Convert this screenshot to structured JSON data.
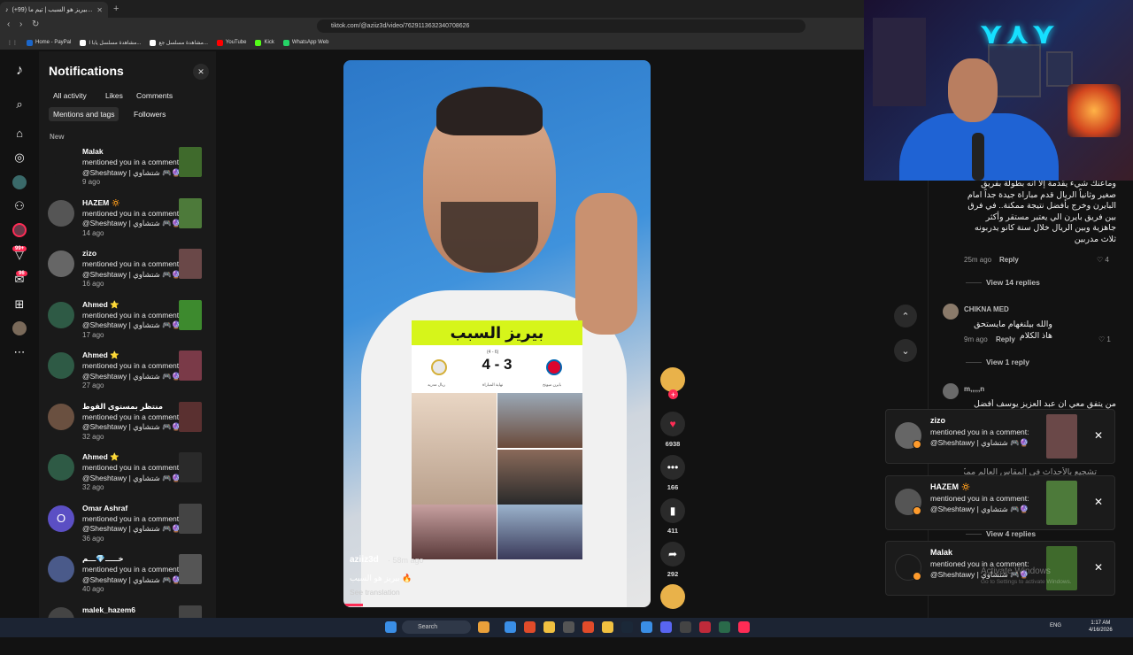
{
  "browser": {
    "tab_title": "(+99) بيريز هو السبب | تيم ما...",
    "url": "tiktok.com/@aziiz3d/video/7629113632340708626",
    "bookmarks": [
      {
        "label": "Home - PayPal",
        "color": "#1b66c9"
      },
      {
        "label": "مشاهدة مسلسل يابا ا...",
        "color": "#ffffff"
      },
      {
        "label": "مشاهدة مسلسل جع...",
        "color": "#ffffff"
      },
      {
        "label": "YouTube",
        "color": "#ff0000"
      },
      {
        "label": "Kick",
        "color": "#53fc18"
      },
      {
        "label": "WhatsApp Web",
        "color": "#25d366"
      }
    ]
  },
  "rail": {
    "icons": [
      "tiktok-logo-icon",
      "search-icon",
      "home-icon",
      "explore-icon",
      "following-icon",
      "friends-icon",
      "live-icon",
      "activity-icon",
      "messages-icon",
      "upload-icon",
      "profile-icon",
      "more-icon"
    ],
    "activity_badge": "99+",
    "messages_badge": "96"
  },
  "notifications": {
    "title": "Notifications",
    "filters": [
      "All activity",
      "Likes",
      "Comments"
    ],
    "filters2": [
      "Mentions and tags",
      "Followers"
    ],
    "section": "New",
    "items": [
      {
        "user": "Malak",
        "text": "mentioned you in a comment: @Sheshtawy | شتشاوي 🎮🔮",
        "time": "9 ago",
        "avatar": "#1a1a1a",
        "thumb": "#3f6a2c"
      },
      {
        "user": "HAZEM 🔅",
        "text": "mentioned you in a comment: @Sheshtawy | شتشاوي 🎮🔮",
        "time": "14 ago",
        "avatar": "#555",
        "thumb": "#4d7a3a"
      },
      {
        "user": "zizo",
        "text": "mentioned you in a comment: @Sheshtawy | شتشاوي 🎮🔮",
        "time": "16 ago",
        "avatar": "#666",
        "thumb": "#6a4848"
      },
      {
        "user": "Ahmed ⭐",
        "text": "mentioned you in a comment: @Sheshtawy | شتشاوي 🎮🔮",
        "time": "17 ago",
        "avatar": "#2e5a45",
        "thumb": "#3d8a2e"
      },
      {
        "user": "Ahmed ⭐",
        "text": "mentioned you in a comment: @Sheshtawy | شتشاوي 🎮🔮",
        "time": "27 ago",
        "avatar": "#2e5a45",
        "thumb": "#7a3a48"
      },
      {
        "user": "منتظر بمستوى القوط",
        "text": "mentioned you in a comment: @Sheshtawy | شتشاوي 🎮🔮",
        "time": "32 ago",
        "avatar": "#6a5040",
        "thumb": "#5a3030"
      },
      {
        "user": "Ahmed ⭐",
        "text": "mentioned you in a comment: @Sheshtawy | شتشاوي 🎮🔮",
        "time": "32 ago",
        "avatar": "#2e5a45",
        "thumb": "#2a2a2a"
      },
      {
        "user": "Omar Ashraf",
        "text": "mentioned you in a comment: @Sheshtawy | شتشاوي 🎮🔮",
        "time": "36 ago",
        "avatar": "#5b4fc4",
        "thumb": "#444",
        "initial": "O"
      },
      {
        "user": "خـــــ💎ـــم",
        "text": "mentioned you in a comment: @Sheshtawy | شتشاوي 🎮🔮",
        "time": "40 ago",
        "avatar": "#4a5a8a",
        "thumb": "#555"
      },
      {
        "user": "malek_hazem6",
        "text": "",
        "time": "",
        "avatar": "#444",
        "thumb": "#444"
      }
    ]
  },
  "video": {
    "card_title": "بيريز السبب",
    "score": "4 - 3",
    "penalties": "(4 - 6)",
    "label_left": "بايرن ميونخ",
    "label_mid": "نهاية المباراة",
    "label_right": "ريال مدريد",
    "author": "aziiz3d",
    "time": "· 58m ago",
    "caption": "بيريز هو السبب 🔥",
    "see_translation": "See translation"
  },
  "actions": {
    "likes": "6938",
    "comments": "166",
    "saves": "411",
    "shares": "292"
  },
  "comments": [
    {
      "text": "وماعنك شيء يقدمة إلا أنه بطولة بفريق صغير وثانياً الريال قدم مباراة جيدة جداً امام البايرن وخرج بأفضل نتيجة ممكنة.. في فرق بين فريق بايرن الي يعتبر مستقر وأكثر جاهزية وبين الريال خلال سنة كانو يدربونه ثلاث مدربين",
      "time": "25m ago",
      "reply": "Reply",
      "likes": "4",
      "view_replies": "View 14 replies"
    },
    {
      "name": "CHIKNA MED",
      "text": "والله بيلنغهام مايستحق هاذ الكلام",
      "time": "9m ago",
      "reply": "Reply",
      "likes": "1",
      "view_replies": "View 1 reply"
    },
    {
      "name": "m,,,,,n",
      "text": "من يتفق معي ان عبد العزيز يوسف أفضل"
    },
    {
      "partial": "تشجيع بالأحداث في المقاس العالم ممكنة",
      "view_replies": "View 4 replies"
    }
  ],
  "toasts": [
    {
      "user": "zizo",
      "text": "mentioned you in a comment: @Sheshtawy | شتشاوي 🎮🔮",
      "thumb": "#6a4848"
    },
    {
      "user": "HAZEM 🔅",
      "text": "mentioned you in a comment: @Sheshtawy | شتشاوي 🎮🔮",
      "thumb": "#4d7a3a"
    },
    {
      "user": "Malak",
      "text": "mentioned you in a comment: @Sheshtawy | شتشاوي 🎮🔮",
      "thumb": "#3f6a2c"
    }
  ],
  "watermark": {
    "line1": "Activate Windows",
    "line2": "Go to Settings to activate Windows."
  },
  "taskbar": {
    "search": "Search",
    "time": "1:17 AM",
    "date": "4/16/2026",
    "lang": "ENG"
  }
}
